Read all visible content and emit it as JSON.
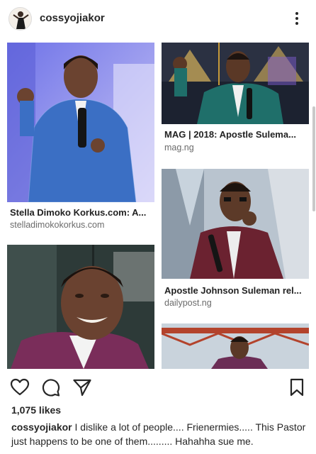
{
  "header": {
    "username": "cossyojiakor",
    "avatar_icon": "profile-avatar",
    "more_icon": "more-vertical-icon"
  },
  "results": [
    {
      "title": "Stella Dimoko Korkus.com: A...",
      "source": "stelladimokokorkus.com"
    },
    {
      "title": "MAG | 2018: Apostle Sulema...",
      "source": "mag.ng"
    },
    {
      "title": "Apostle Johnson Suleman rel...",
      "source": "dailypost.ng"
    }
  ],
  "actions": {
    "like_icon": "heart-icon",
    "comment_icon": "comment-icon",
    "share_icon": "send-icon",
    "save_icon": "bookmark-icon"
  },
  "post": {
    "likes": "1,075 likes",
    "caption_user": "cossyojiakor",
    "caption_text": " I  dislike a lot of people.... Frienermies..... This Pastor just happens to be one of them......... Hahahha sue me."
  },
  "colors": {
    "text": "#262626",
    "muted": "#6b6b6b",
    "jacket_blue": "#3b6fc4",
    "jacket_purple": "#7a2d5a",
    "jacket_green": "#1f6f6a"
  }
}
